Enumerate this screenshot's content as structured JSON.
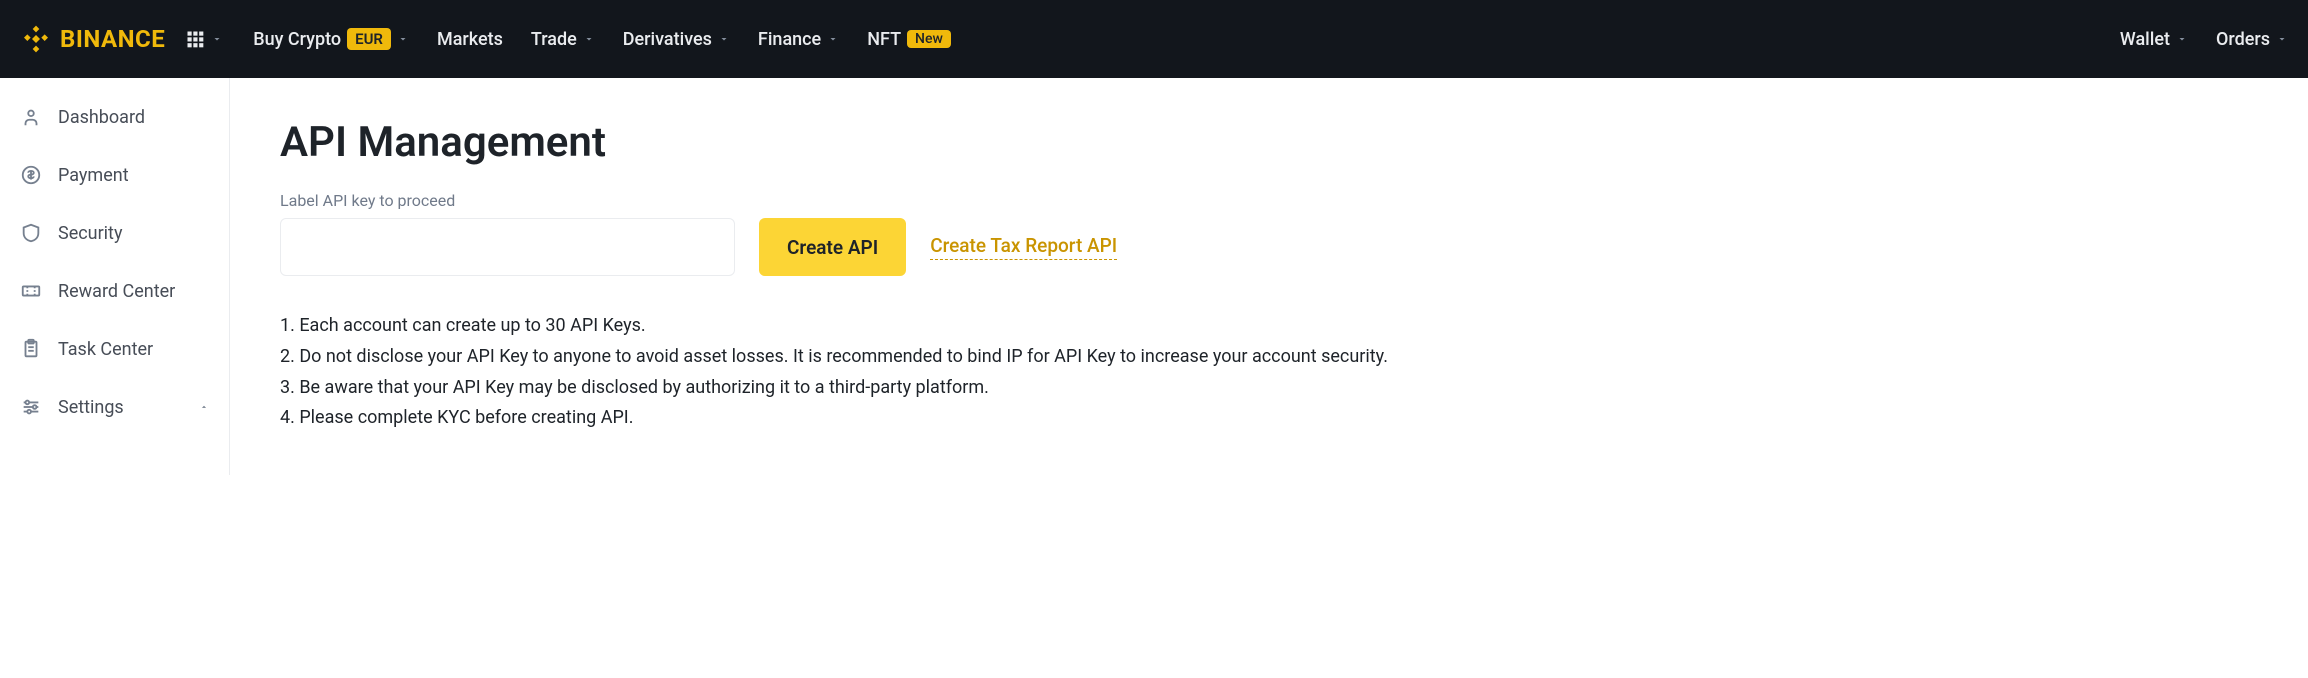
{
  "header": {
    "brand": "BINANCE",
    "nav_left": [
      {
        "label": "Buy Crypto",
        "badge": "EUR",
        "has_chevron": true
      },
      {
        "label": "Markets",
        "has_chevron": false
      },
      {
        "label": "Trade",
        "has_chevron": true
      },
      {
        "label": "Derivatives",
        "has_chevron": true
      },
      {
        "label": "Finance",
        "has_chevron": true
      },
      {
        "label": "NFT",
        "badge_new": "New",
        "has_chevron": false
      }
    ],
    "nav_right": [
      {
        "label": "Wallet",
        "has_chevron": true
      },
      {
        "label": "Orders",
        "has_chevron": true
      }
    ]
  },
  "sidebar": {
    "items": [
      {
        "icon": "person",
        "label": "Dashboard"
      },
      {
        "icon": "dollar",
        "label": "Payment"
      },
      {
        "icon": "shield",
        "label": "Security"
      },
      {
        "icon": "ticket",
        "label": "Reward Center"
      },
      {
        "icon": "clipboard",
        "label": "Task Center"
      },
      {
        "icon": "sliders",
        "label": "Settings",
        "expandable": true
      }
    ]
  },
  "main": {
    "title": "API Management",
    "input_label": "Label API key to proceed",
    "input_value": "",
    "create_button": "Create API",
    "tax_link": "Create Tax Report API",
    "info": [
      "1. Each account can create up to 30 API Keys.",
      "2. Do not disclose your API Key to anyone to avoid asset losses. It is recommended to bind IP for API Key to increase your account security.",
      "3. Be aware that your API Key may be disclosed by authorizing it to a third-party platform.",
      "4. Please complete KYC before creating API."
    ]
  }
}
